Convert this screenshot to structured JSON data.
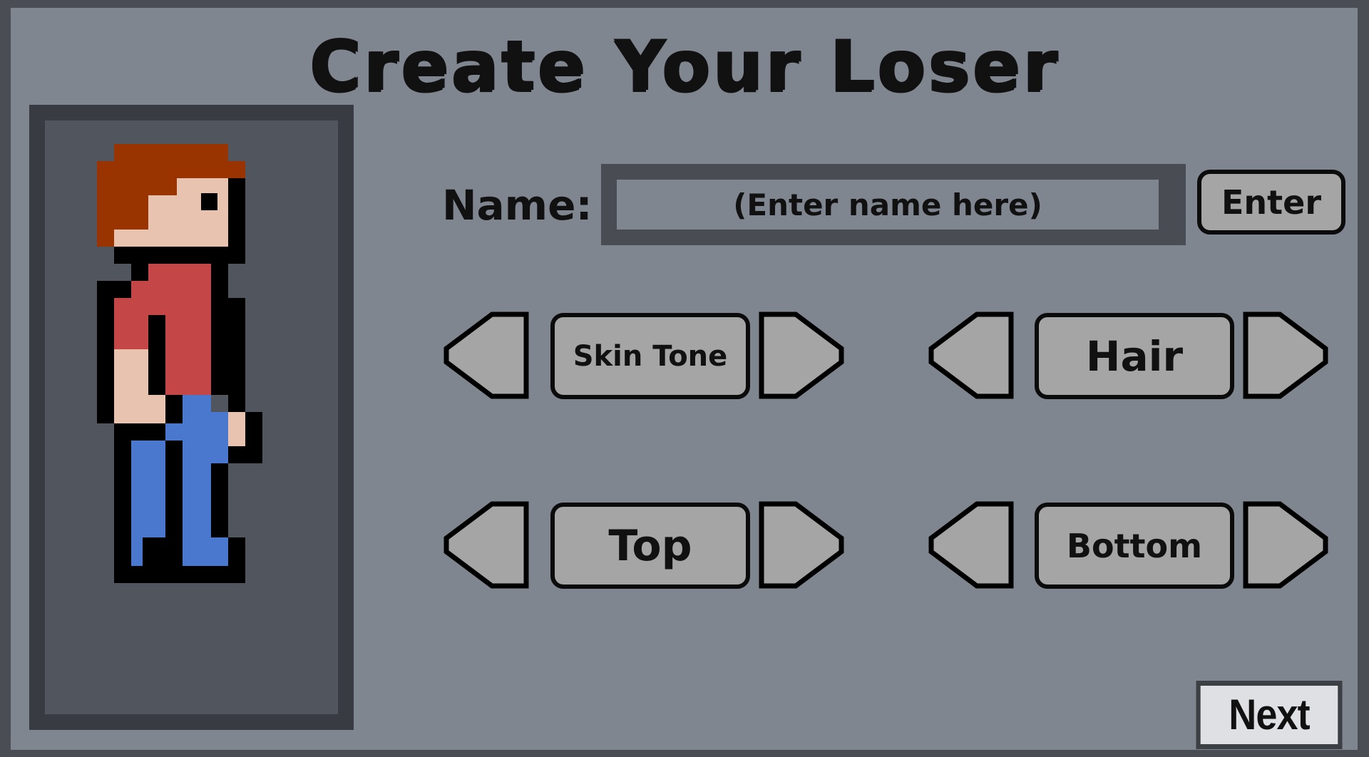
{
  "title": "Create Your Loser",
  "name_field": {
    "label": "Name:",
    "placeholder": "(Enter name here)",
    "value": ""
  },
  "enter_button": "Enter",
  "selectors": {
    "skin_tone": {
      "label": "Skin Tone",
      "prev_icon": "left-arrow-icon",
      "next_icon": "right-arrow-icon"
    },
    "hair": {
      "label": "Hair",
      "prev_icon": "left-arrow-icon",
      "next_icon": "right-arrow-icon"
    },
    "top": {
      "label": "Top",
      "prev_icon": "left-arrow-icon",
      "next_icon": "right-arrow-icon"
    },
    "bottom": {
      "label": "Bottom",
      "prev_icon": "left-arrow-icon",
      "next_icon": "right-arrow-icon"
    }
  },
  "next_button": "Next",
  "colors": {
    "hair": "#993300",
    "skin": "#e8c3b0",
    "top": "#c54646",
    "bottom": "#4a78cf",
    "outline": "#000000",
    "background": "#80868f",
    "button": "#a5a5a5"
  }
}
